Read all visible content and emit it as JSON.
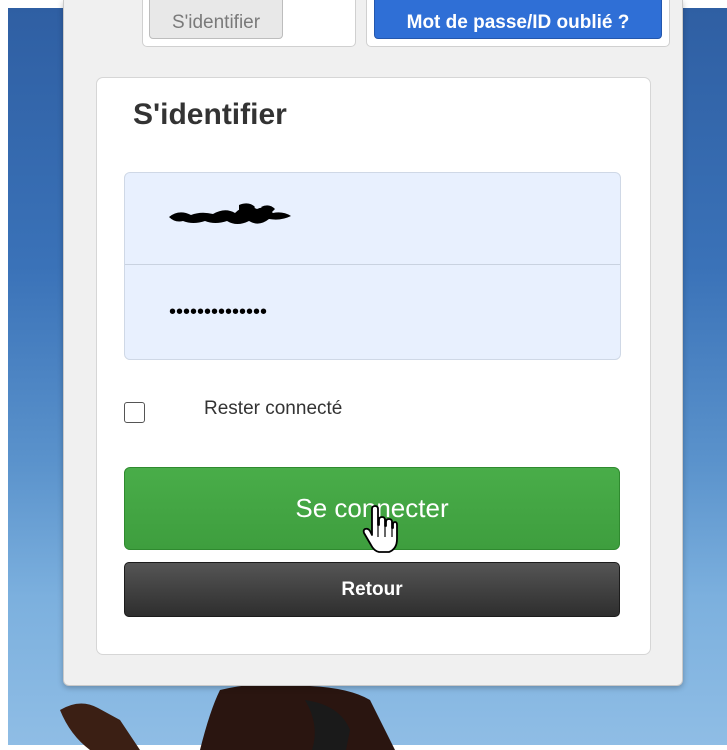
{
  "tabs": {
    "identify_label": "S'identifier",
    "forgot_label": "Mot de passe/ID oublié ?"
  },
  "login": {
    "title": "S'identifier",
    "username_value": "",
    "password_value": "••••••••••••••",
    "remember_label": "Rester connecté",
    "remember_checked": false,
    "connect_label": "Se connecter",
    "back_label": "Retour"
  },
  "colors": {
    "connect_button": "#3e9e3e",
    "back_button": "#333333",
    "forgot_button": "#2f6fd6",
    "field_background": "#e8f0fe"
  },
  "icons": {
    "cursor": "hand-pointer-icon"
  }
}
